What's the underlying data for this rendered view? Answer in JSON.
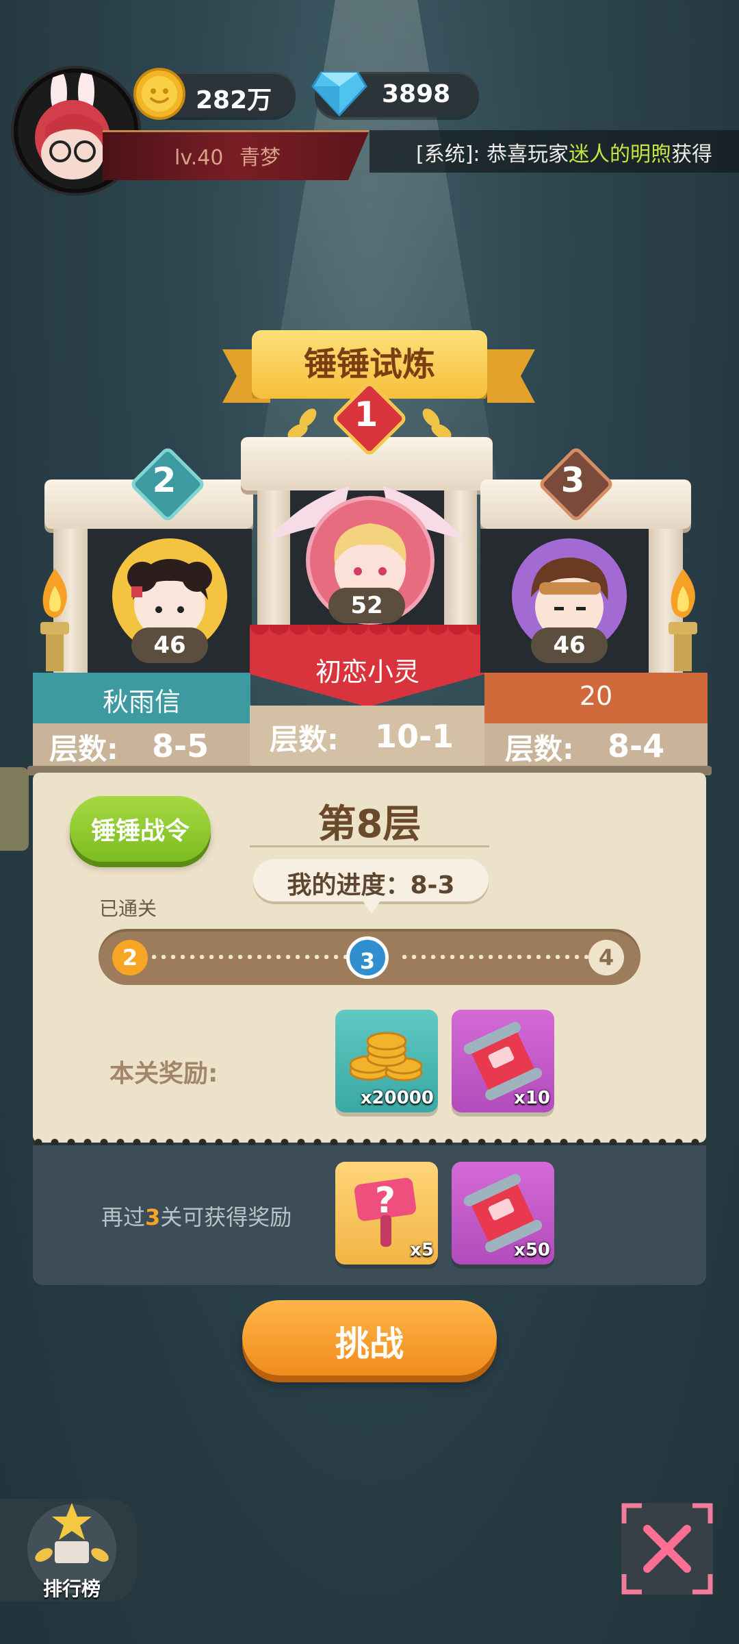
{
  "header": {
    "coins": "282万",
    "gems": "3898",
    "level": "lv.40",
    "player_name": "青梦",
    "ticker_prefix": "[系统]: 恭喜玩家",
    "ticker_name": "迷人的明煦",
    "ticker_suffix": "获得"
  },
  "trial": {
    "title": "锤锤试炼",
    "podium": [
      {
        "rank": "1",
        "level": "52",
        "name": "初恋小灵",
        "floor_label": "层数:",
        "floor": "10-1"
      },
      {
        "rank": "2",
        "level": "46",
        "name": "秋雨信",
        "floor_label": "层数:",
        "floor": "8-5"
      },
      {
        "rank": "3",
        "level": "46",
        "name": "20",
        "floor_label": "层数:",
        "floor": "8-4"
      }
    ]
  },
  "panel": {
    "pass_button": "锤锤战令",
    "floor_title": "第8层",
    "my_progress": "我的进度：8-3",
    "passed_label": "已通关",
    "track_nodes": [
      "2",
      "3",
      "4"
    ],
    "reward_label": "本关奖励:",
    "rewards": [
      {
        "icon": "coin-stack-icon",
        "qty": "x20000"
      },
      {
        "icon": "ticket-scroll-icon",
        "qty": "x10"
      }
    ],
    "next_prefix": "再过",
    "next_count": "3",
    "next_suffix": "关可获得奖励",
    "next_rewards": [
      {
        "icon": "mystery-hammer-icon",
        "qty": "x5"
      },
      {
        "icon": "ticket-scroll-icon",
        "qty": "x50"
      }
    ]
  },
  "actions": {
    "challenge": "挑战",
    "leaderboard": "排行榜"
  },
  "colors": {
    "accent_orange": "#f08d1c",
    "pass_green": "#7cbc1f",
    "rank1_red": "#d9343e",
    "rank2_teal": "#3c9aa0",
    "rank3_orange": "#d06a3b"
  }
}
